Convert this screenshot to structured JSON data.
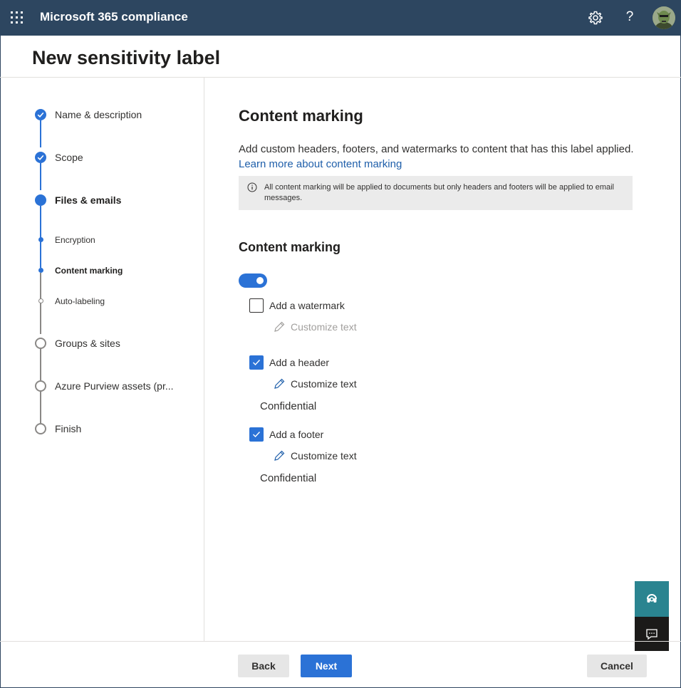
{
  "header": {
    "app_title": "Microsoft 365 compliance",
    "help_glyph": "?",
    "icons": [
      "waffle-icon",
      "gear-icon",
      "help-icon",
      "avatar"
    ],
    "bar_color": "#2d4660"
  },
  "page": {
    "title": "New sensitivity label"
  },
  "steps": [
    {
      "label": "Name & description",
      "state": "done"
    },
    {
      "label": "Scope",
      "state": "done"
    },
    {
      "label": "Files & emails",
      "state": "current"
    },
    {
      "label": "Encryption",
      "state": "sub-done"
    },
    {
      "label": "Content marking",
      "state": "sub-current"
    },
    {
      "label": "Auto-labeling",
      "state": "sub-pending"
    },
    {
      "label": "Groups & sites",
      "state": "pending"
    },
    {
      "label": "Azure Purview assets (pr...",
      "state": "pending"
    },
    {
      "label": "Finish",
      "state": "pending"
    }
  ],
  "content": {
    "title": "Content marking",
    "description": "Add custom headers, footers, and watermarks to content that has this label applied.",
    "learn_more": "Learn more about content marking",
    "info": "All content marking will be applied to documents but only headers and footers will be applied to email messages.",
    "subsection_title": "Content marking",
    "toggle_on": true,
    "watermark": {
      "label": "Add a watermark",
      "checked": false,
      "customize": "Customize text"
    },
    "header": {
      "label": "Add a header",
      "checked": true,
      "customize": "Customize text",
      "value": "Confidential"
    },
    "footer": {
      "label": "Add a footer",
      "checked": true,
      "customize": "Customize text",
      "value": "Confidential"
    }
  },
  "footer": {
    "back": "Back",
    "next": "Next",
    "cancel": "Cancel"
  },
  "colors": {
    "accent": "#2b72d6",
    "support_button": "#2a8490",
    "feedback_button": "#1b1a19"
  }
}
